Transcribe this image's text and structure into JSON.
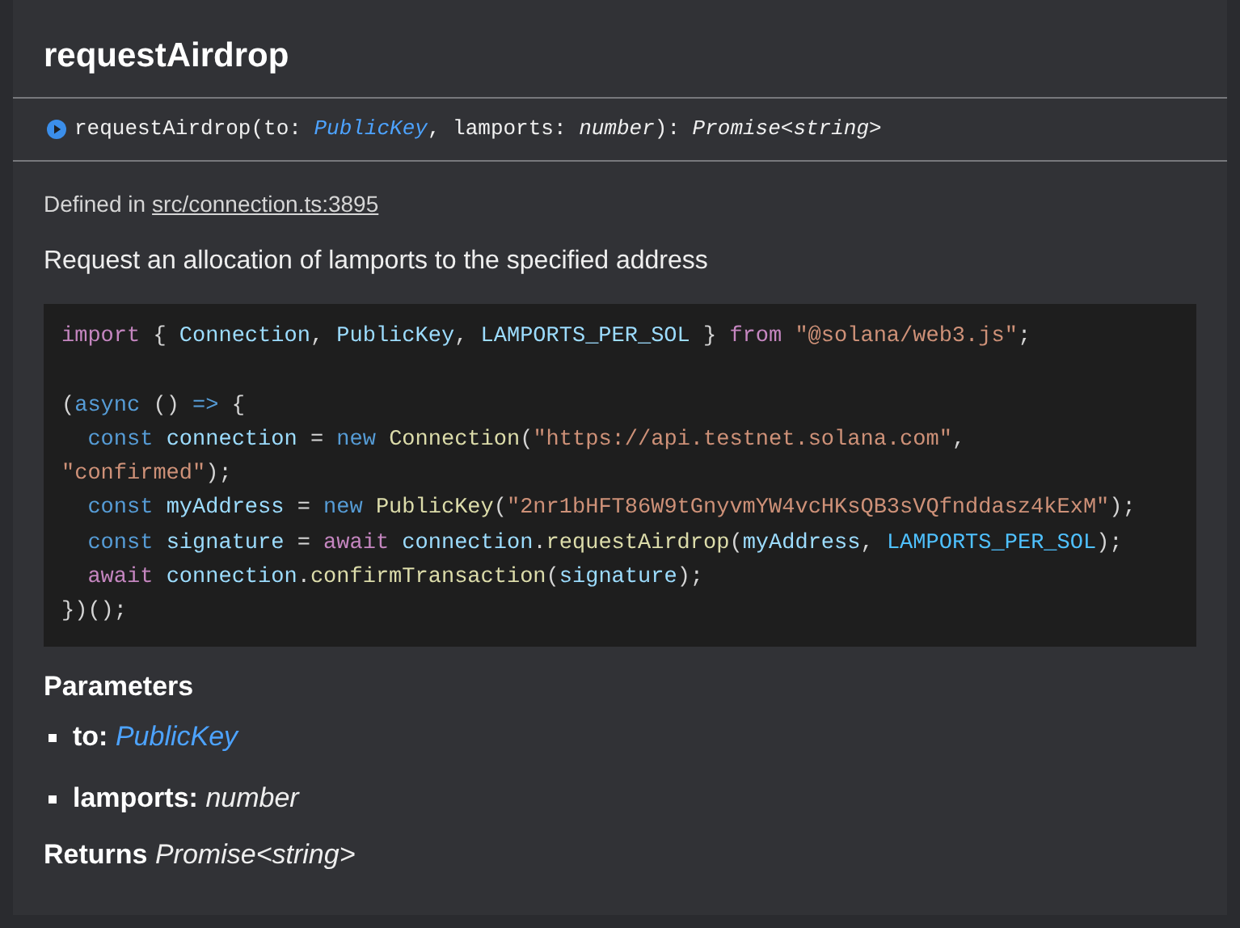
{
  "title": "requestAirdrop",
  "signature": [
    {
      "kind": "plain",
      "text": "requestAirdrop(to: "
    },
    {
      "kind": "link",
      "text": "PublicKey"
    },
    {
      "kind": "plain",
      "text": ", lamports: "
    },
    {
      "kind": "type",
      "text": "number"
    },
    {
      "kind": "plain",
      "text": "): "
    },
    {
      "kind": "type",
      "text": "Promise<string>"
    }
  ],
  "defined_in": {
    "label": "Defined in",
    "link": "src/connection.ts:3895"
  },
  "description": "Request an allocation of lamports to the specified address",
  "code_lines": [
    [
      {
        "kind": "keyword",
        "text": "import"
      },
      {
        "kind": "plain",
        "text": " { "
      },
      {
        "kind": "variable",
        "text": "Connection"
      },
      {
        "kind": "plain",
        "text": ", "
      },
      {
        "kind": "variable",
        "text": "PublicKey"
      },
      {
        "kind": "plain",
        "text": ", "
      },
      {
        "kind": "variable",
        "text": "LAMPORTS_PER_SOL"
      },
      {
        "kind": "plain",
        "text": " } "
      },
      {
        "kind": "keyword",
        "text": "from"
      },
      {
        "kind": "string",
        "text": " \"@solana/web3.js\""
      },
      {
        "kind": "plain",
        "text": ";"
      }
    ],
    [
      {
        "kind": "plain",
        "text": "\n("
      },
      {
        "kind": "storage",
        "text": "async"
      },
      {
        "kind": "plain",
        "text": " () "
      },
      {
        "kind": "storage",
        "text": "=>"
      },
      {
        "kind": "plain",
        "text": " {"
      }
    ],
    [
      {
        "kind": "storage",
        "text": "  const"
      },
      {
        "kind": "variable",
        "text": " connection"
      },
      {
        "kind": "plain",
        "text": " = "
      },
      {
        "kind": "storage",
        "text": "new"
      },
      {
        "kind": "function",
        "text": " Connection"
      },
      {
        "kind": "plain",
        "text": "("
      },
      {
        "kind": "string",
        "text": "\"https://api.testnet.solana.com\""
      },
      {
        "kind": "plain",
        "text": ","
      }
    ],
    [
      {
        "kind": "string",
        "text": "\"confirmed\""
      },
      {
        "kind": "plain",
        "text": ");"
      }
    ],
    [
      {
        "kind": "storage",
        "text": "  const"
      },
      {
        "kind": "variable",
        "text": " myAddress"
      },
      {
        "kind": "plain",
        "text": " = "
      },
      {
        "kind": "storage",
        "text": "new"
      },
      {
        "kind": "function",
        "text": " PublicKey"
      },
      {
        "kind": "plain",
        "text": "("
      },
      {
        "kind": "string",
        "text": "\"2nr1bHFT86W9tGnyvmYW4vcHKsQB3sVQfnddasz4kExM\""
      },
      {
        "kind": "plain",
        "text": ");"
      }
    ],
    [
      {
        "kind": "storage",
        "text": "  const"
      },
      {
        "kind": "variable",
        "text": " signature"
      },
      {
        "kind": "plain",
        "text": " = "
      },
      {
        "kind": "keyword",
        "text": "await"
      },
      {
        "kind": "variable",
        "text": " connection"
      },
      {
        "kind": "plain",
        "text": "."
      },
      {
        "kind": "function",
        "text": "requestAirdrop"
      },
      {
        "kind": "plain",
        "text": "("
      },
      {
        "kind": "variable",
        "text": "myAddress"
      },
      {
        "kind": "plain",
        "text": ", "
      },
      {
        "kind": "constant",
        "text": "LAMPORTS_PER_SOL"
      },
      {
        "kind": "plain",
        "text": ");"
      }
    ],
    [
      {
        "kind": "keyword",
        "text": "  await"
      },
      {
        "kind": "variable",
        "text": " connection"
      },
      {
        "kind": "plain",
        "text": "."
      },
      {
        "kind": "function",
        "text": "confirmTransaction"
      },
      {
        "kind": "plain",
        "text": "("
      },
      {
        "kind": "variable",
        "text": "signature"
      },
      {
        "kind": "plain",
        "text": ");"
      }
    ],
    [
      {
        "kind": "plain",
        "text": "})();"
      }
    ]
  ],
  "parameters": {
    "heading": "Parameters",
    "items": [
      {
        "name": "to:",
        "type": "PublicKey",
        "kind": "link"
      },
      {
        "name": "lamports:",
        "type": "number",
        "kind": "type"
      }
    ]
  },
  "returns": {
    "label": "Returns",
    "type": "Promise<string>"
  }
}
